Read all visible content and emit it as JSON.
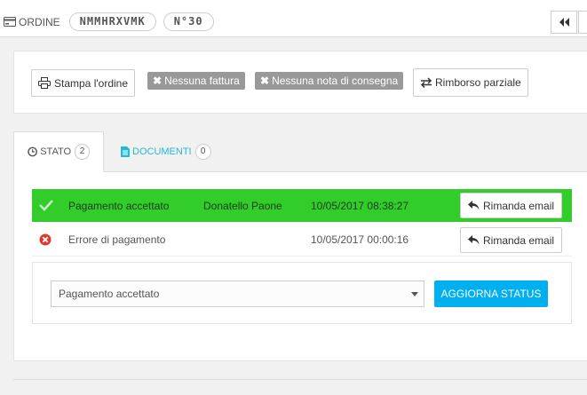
{
  "header": {
    "label": "ORDINE",
    "reference": "NMMHRXVMK",
    "number": "N°30"
  },
  "actions": {
    "print": "Stampa l'ordine",
    "no_invoice": "Nessuna fattura",
    "no_delivery": "Nessuna nota di consegna",
    "partial_refund": "Rimborso parziale"
  },
  "tabs": [
    {
      "label": "STATO",
      "count": "2"
    },
    {
      "label": "DOCUMENTI",
      "count": "0"
    }
  ],
  "history": [
    {
      "status": "Pagamento accettato",
      "employee": "Donatello Paone",
      "date": "10/05/2017 08:38:27",
      "resend": "Rimanda email"
    },
    {
      "status": "Errore di pagamento",
      "employee": "",
      "date": "10/05/2017 00:00:16",
      "resend": "Rimanda email"
    }
  ],
  "status_update": {
    "selected": "Pagamento accettato",
    "button": "AGGIORNA STATUS"
  },
  "colors": {
    "accepted_row": "#32cc2b",
    "primary": "#00aff0",
    "tab_link": "#25b9d7",
    "error": "#e03a2f"
  }
}
